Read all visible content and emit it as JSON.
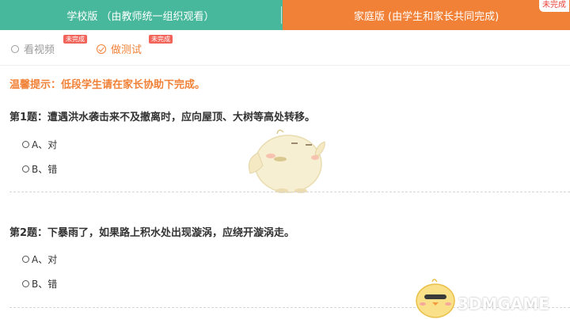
{
  "tabs": {
    "school_label": "学校版 （由教师统一组织观看）",
    "home_label": "家庭版 (由学生和家长共同完成)",
    "home_badge": "未完成"
  },
  "subtabs": {
    "video_label": "看视频",
    "video_badge": "未完成",
    "test_label": "做测试",
    "test_badge": "未完成"
  },
  "notice": "温馨提示：低段学生请在家长协助下完成。",
  "questions": [
    {
      "text": "第1题：遭遇洪水袭击来不及撤离时，应向屋顶、大树等高处转移。",
      "options": [
        "A、对",
        "B、错"
      ]
    },
    {
      "text": "第2题：下暴雨了，如果路上积水处出现漩涡，应绕开漩涡走。",
      "options": [
        "A、对",
        "B、错"
      ]
    }
  ],
  "watermark": {
    "text": "3DMGAME"
  },
  "colors": {
    "school_tab": "#47b89b",
    "home_tab": "#f18137",
    "badge_red": "#f2645a",
    "text_dark": "#333333",
    "text_gray": "#9a9a9a"
  }
}
